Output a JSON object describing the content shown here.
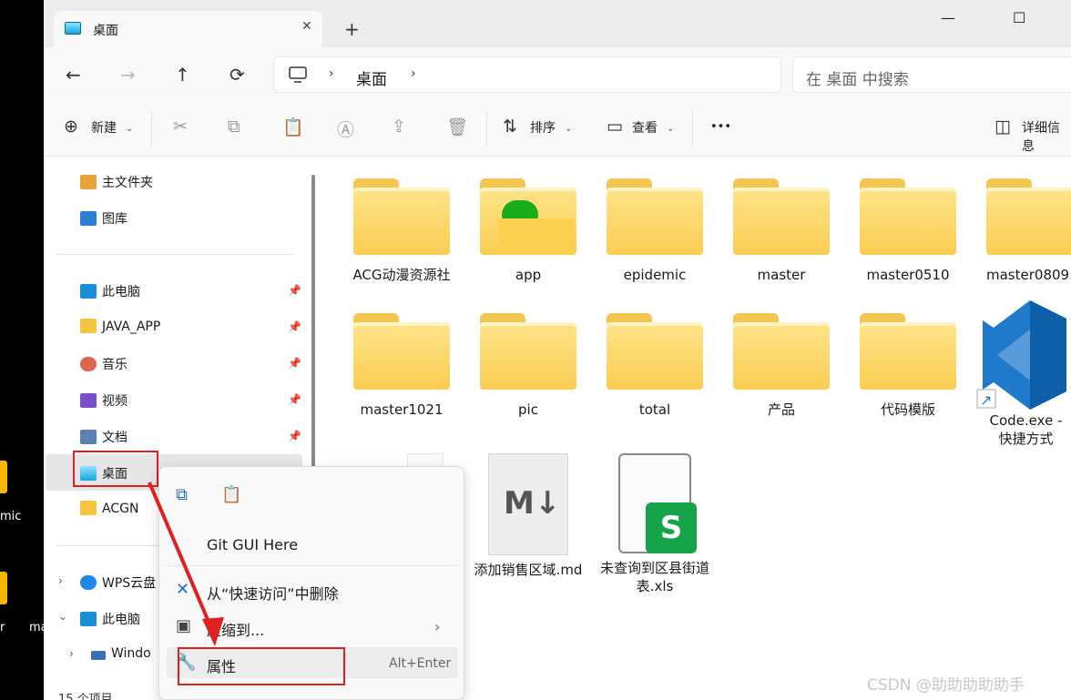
{
  "desktop": {
    "text1": "mic",
    "text2": "r",
    "text3": "ma"
  },
  "window": {
    "tab_title": "桌面",
    "close_tab": "✕",
    "new_tab": "+",
    "minimize": "—",
    "maximize": "☐",
    "close": "✕"
  },
  "nav": {
    "back": "←",
    "forward": "→",
    "up": "↑",
    "refresh": "⟳",
    "breadcrumb": "桌面",
    "search_placeholder": "在 桌面 中搜索"
  },
  "toolbar": {
    "new": "新建",
    "sort": "排序",
    "view": "查看",
    "more": "•••",
    "details": "详细信息"
  },
  "sidebar": {
    "home": "主文件夹",
    "gallery": "图库",
    "items": [
      "此电脑",
      "JAVA_APP",
      "音乐",
      "视频",
      "文档",
      "桌面",
      "ACGN"
    ],
    "wps": "WPS云盘",
    "this_pc": "此电脑",
    "windows": "Windo",
    "status": "15 个项目"
  },
  "files": [
    {
      "name": "ACG动漫资源社"
    },
    {
      "name": "app"
    },
    {
      "name": "epidemic"
    },
    {
      "name": "master"
    },
    {
      "name": "master0510"
    },
    {
      "name": "master0809"
    },
    {
      "name": "master1021"
    },
    {
      "name": "pic"
    },
    {
      "name": "total"
    },
    {
      "name": "产品"
    },
    {
      "name": "代码模版"
    },
    {
      "name": "Code.exe - 快捷方式"
    },
    {
      "name": "添加销售区域.md"
    },
    {
      "name": "未查询到区县街道表.xls"
    }
  ],
  "context_menu": {
    "git": "Git GUI Here",
    "remove": "从“快速访问”中删除",
    "compress": "压缩到...",
    "properties": "属性",
    "shortcut": "Alt+Enter"
  },
  "watermark": "CSDN @助助助助助手",
  "colors": {
    "annotation": "#e02020",
    "folder": "#f9cd52"
  }
}
